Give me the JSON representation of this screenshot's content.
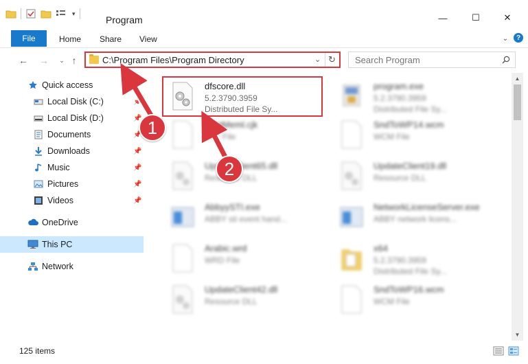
{
  "window": {
    "title": "Program",
    "minimize": "—",
    "maximize": "☐",
    "close": "✕"
  },
  "ribbon": {
    "file": "File",
    "home": "Home",
    "share": "Share",
    "view": "View"
  },
  "address": {
    "path": "C:\\Program Files\\Program Directory",
    "refresh": "↻"
  },
  "search": {
    "placeholder": "Search Program"
  },
  "sidebar": {
    "items": [
      {
        "label": "Quick access",
        "icon": "star-icon"
      },
      {
        "label": "Local Disk (C:)",
        "icon": "drive-icon",
        "pinned": true
      },
      {
        "label": "Local Disk (D:)",
        "icon": "drive-icon",
        "pinned": true
      },
      {
        "label": "Documents",
        "icon": "documents-icon",
        "pinned": true
      },
      {
        "label": "Downloads",
        "icon": "download-icon",
        "pinned": true
      },
      {
        "label": "Music",
        "icon": "music-icon",
        "pinned": true
      },
      {
        "label": "Pictures",
        "icon": "pictures-icon",
        "pinned": true
      },
      {
        "label": "Videos",
        "icon": "videos-icon",
        "pinned": true
      },
      {
        "label": "OneDrive",
        "icon": "cloud-icon"
      },
      {
        "label": "This PC",
        "icon": "pc-icon",
        "selected": true
      },
      {
        "label": "Network",
        "icon": "network-icon"
      }
    ]
  },
  "files": [
    {
      "name": "dfscore.dll",
      "line1": "5.2.3790.3959",
      "line2": "Distributed File Sy...",
      "icon": "dll-gear-icon"
    },
    {
      "name": "program.exe",
      "line1": "5.2.3790.3959",
      "line2": "Distributed File Sy...",
      "icon": "exe-icon"
    },
    {
      "name": "PostMeml.cjk",
      "line1": "CJK File",
      "line2": "",
      "icon": "blank-file-icon"
    },
    {
      "name": "SndToWP14.wcm",
      "line1": "WCM File",
      "line2": "",
      "icon": "blank-file-icon"
    },
    {
      "name": "UpdateClient65.dll",
      "line1": "Resource DLL",
      "line2": "",
      "icon": "dll-gear-icon"
    },
    {
      "name": "UpdateClient19.dll",
      "line1": "Resource DLL",
      "line2": "",
      "icon": "dll-gear-icon"
    },
    {
      "name": "AbbyySTI.exe",
      "line1": "ABBY sti event hand...",
      "line2": "",
      "icon": "app-window-icon"
    },
    {
      "name": "NetworkLicenseServer.exe",
      "line1": "ABBY network licens...",
      "line2": "",
      "icon": "app-window-icon"
    },
    {
      "name": "Arabic.wrd",
      "line1": "WRD File",
      "line2": "",
      "icon": "blank-file-icon"
    },
    {
      "name": "x64",
      "line1": "5.2.3790.3959",
      "line2": "Distributed File Sy...",
      "icon": "folder-doc-icon"
    },
    {
      "name": "UpdateClient42.dll",
      "line1": "Resource DLL",
      "line2": "",
      "icon": "dll-gear-icon"
    },
    {
      "name": "SndToWP16.wcm",
      "line1": "WCM File",
      "line2": "",
      "icon": "blank-file-icon"
    }
  ],
  "status": {
    "item_count": "125 items"
  },
  "callouts": {
    "step1": "1",
    "step2": "2"
  },
  "colors": {
    "accent": "#1979ca",
    "callout": "#d9363e",
    "selection": "#cce8ff",
    "folder": "#f3c94d"
  }
}
